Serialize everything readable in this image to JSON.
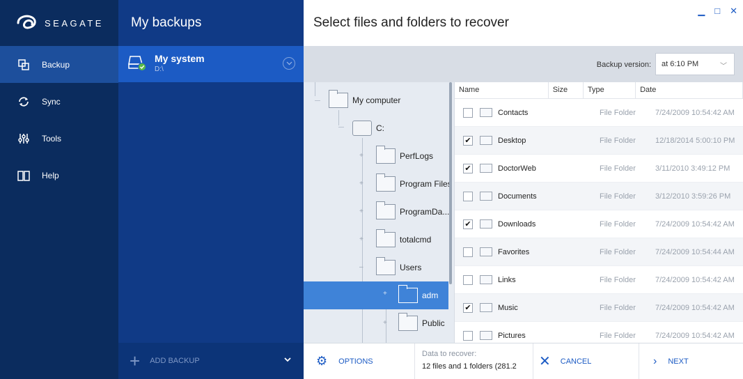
{
  "nav": {
    "brand": "SEAGATE",
    "items": [
      {
        "label": "Backup",
        "icon": "backup-icon"
      },
      {
        "label": "Sync",
        "icon": "sync-icon"
      },
      {
        "label": "Tools",
        "icon": "tools-icon"
      },
      {
        "label": "Help",
        "icon": "help-icon"
      }
    ]
  },
  "backups": {
    "title": "My backups",
    "item": {
      "name": "My system",
      "path": "D:\\"
    },
    "add_label": "ADD BACKUP"
  },
  "main": {
    "title": "Select files and folders to recover",
    "backup_version_label": "Backup version:",
    "backup_version_value": "at 6:10 PM"
  },
  "tree": [
    {
      "label": "My computer",
      "type": "folder"
    },
    {
      "label": "C:",
      "type": "drive"
    },
    {
      "label": "PerfLogs",
      "type": "folder"
    },
    {
      "label": "Program Files",
      "type": "folder"
    },
    {
      "label": "ProgramDa...",
      "type": "folder"
    },
    {
      "label": "totalcmd",
      "type": "folder"
    },
    {
      "label": "Users",
      "type": "folder"
    },
    {
      "label": "adm",
      "type": "folder",
      "selected": true
    },
    {
      "label": "Public",
      "type": "folder"
    }
  ],
  "list": {
    "columns": [
      "Name",
      "Size",
      "Type",
      "Date"
    ],
    "rows": [
      {
        "name": "Contacts",
        "type": "File Folder",
        "date": "7/24/2009 10:54:42 AM",
        "checked": false
      },
      {
        "name": "Desktop",
        "type": "File Folder",
        "date": "12/18/2014 5:00:10 PM",
        "checked": true
      },
      {
        "name": "DoctorWeb",
        "type": "File Folder",
        "date": "3/11/2010 3:49:12 PM",
        "checked": true
      },
      {
        "name": "Documents",
        "type": "File Folder",
        "date": "3/12/2010 3:59:26 PM",
        "checked": false
      },
      {
        "name": "Downloads",
        "type": "File Folder",
        "date": "7/24/2009 10:54:42 AM",
        "checked": true
      },
      {
        "name": "Favorites",
        "type": "File Folder",
        "date": "7/24/2009 10:54:44 AM",
        "checked": false
      },
      {
        "name": "Links",
        "type": "File Folder",
        "date": "7/24/2009 10:54:42 AM",
        "checked": false
      },
      {
        "name": "Music",
        "type": "File Folder",
        "date": "7/24/2009 10:54:42 AM",
        "checked": true
      },
      {
        "name": "Pictures",
        "type": "File Folder",
        "date": "7/24/2009 10:54:42 AM",
        "checked": false
      }
    ]
  },
  "footer": {
    "options_label": "OPTIONS",
    "data_label": "Data to recover:",
    "data_value": "12 files and 1 folders (281.2",
    "cancel_label": "CANCEL",
    "next_label": "NEXT"
  }
}
